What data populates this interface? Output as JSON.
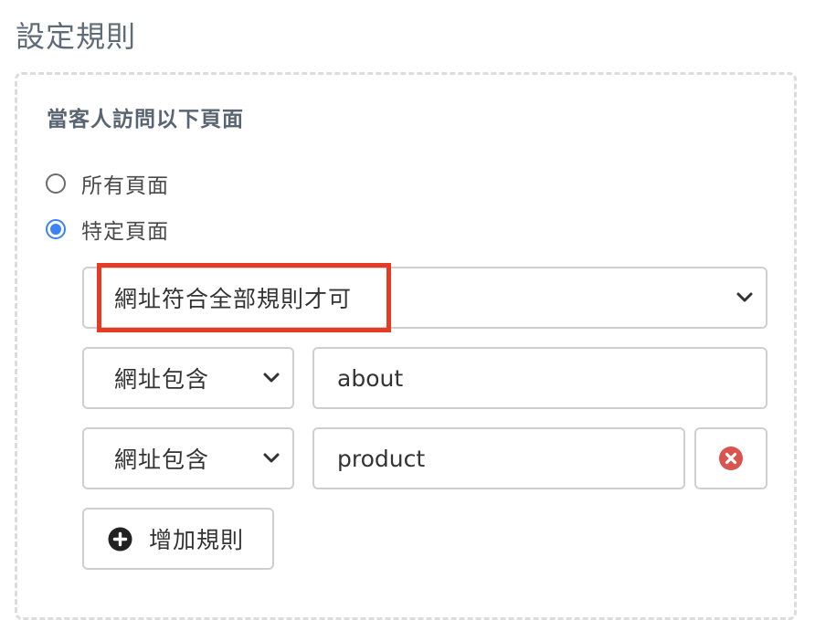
{
  "page_title": "設定規則",
  "section_label": "當客人訪問以下頁面",
  "radio_options": [
    {
      "label": "所有頁面",
      "checked": false
    },
    {
      "label": "特定頁面",
      "checked": true
    }
  ],
  "match_select": {
    "selected": "網址符合全部規則才可"
  },
  "conditions": [
    {
      "operator": "網址包含",
      "value": "about"
    },
    {
      "operator": "網址包含",
      "value": "product"
    }
  ],
  "icons": {
    "remove": "remove-circle-icon",
    "add": "plus-circle-icon",
    "chevron": "chevron-down-icon"
  },
  "colors": {
    "radio_checked": "#3b82f6",
    "remove_icon": "#d9534f",
    "highlight": "#e53a23"
  },
  "add_rule_label": "增加規則"
}
